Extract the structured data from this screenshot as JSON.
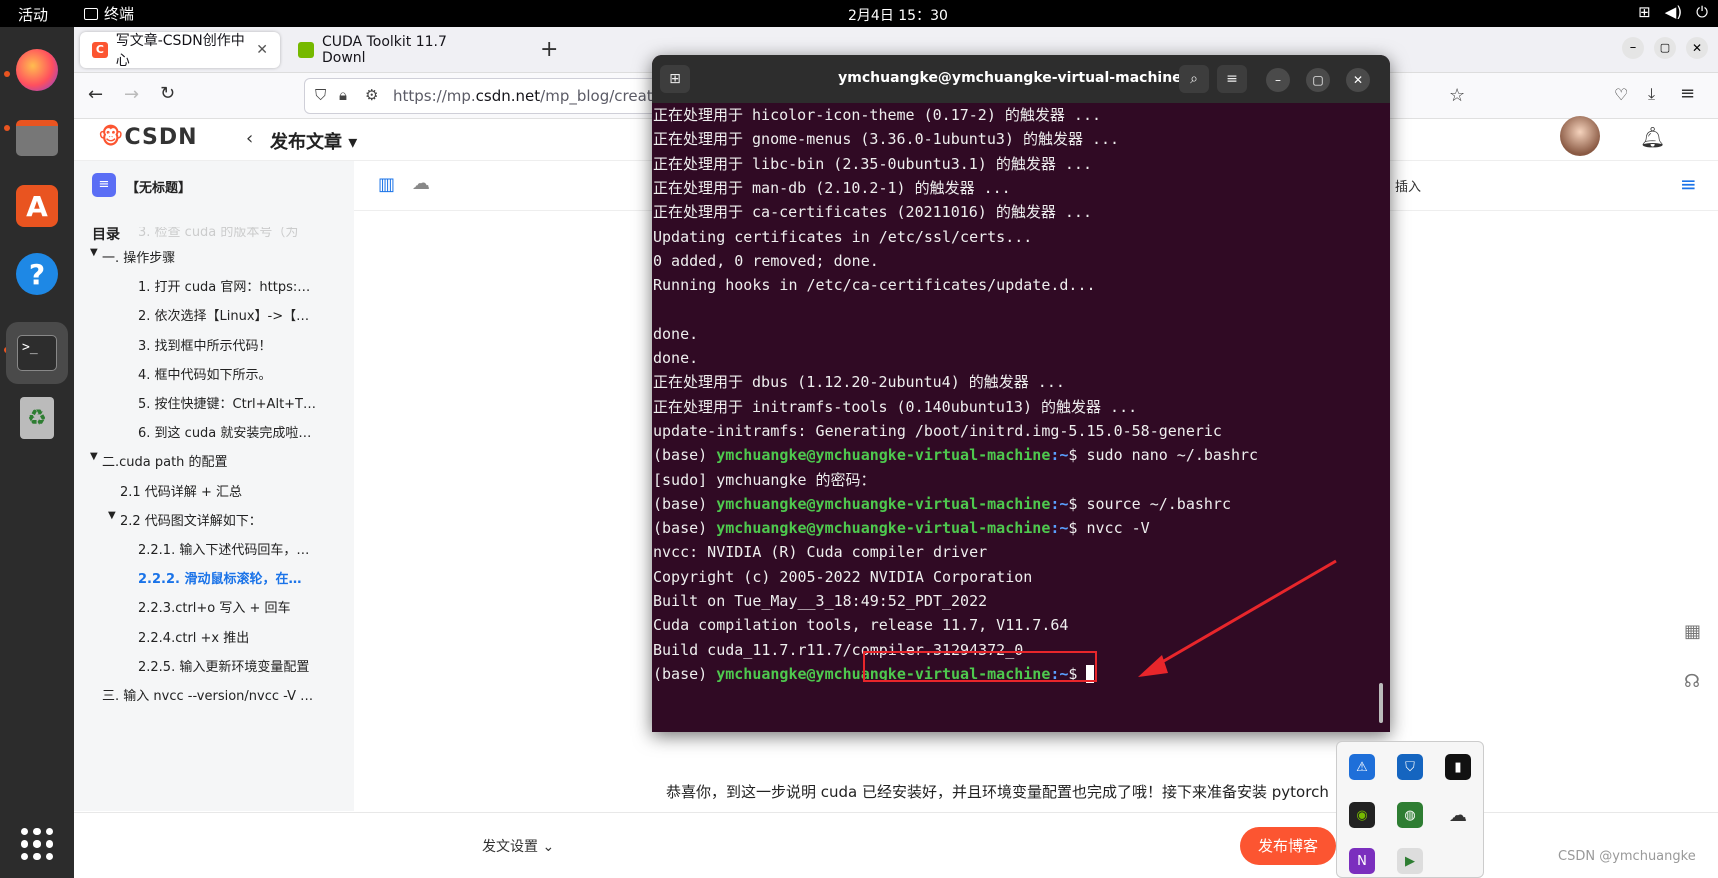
{
  "topbar": {
    "activities": "活动",
    "app": "终端",
    "clock": "2月4日  15：30",
    "sys_icons": [
      "network-icon",
      "volume-icon",
      "power-icon"
    ]
  },
  "browser": {
    "tab1": "写文章-CSDN创作中心",
    "tab2": "CUDA Toolkit 11.7 Downl",
    "url_prefix": "https://mp.",
    "url_domain": "csdn.net",
    "url_rest": "/mp_blog/creatio"
  },
  "csdn": {
    "logo": "CSDN",
    "publish_title": "发布文章",
    "doc_title": "【无标题】",
    "toc_label": "目录",
    "insert_label": "插入",
    "toc": [
      {
        "text": "3. 检查 cuda 的版本号（为",
        "indent": 2,
        "arrow": false,
        "sel": false
      },
      {
        "text": "一. 操作步骤",
        "indent": 0,
        "arrow": true,
        "sel": false
      },
      {
        "text": "1. 打开 cuda 官网：https:…",
        "indent": 2,
        "arrow": false,
        "sel": false
      },
      {
        "text": "2. 依次选择【Linux】->【…",
        "indent": 2,
        "arrow": false,
        "sel": false
      },
      {
        "text": "3. 找到框中所示代码！",
        "indent": 2,
        "arrow": false,
        "sel": false
      },
      {
        "text": "4. 框中代码如下所示。",
        "indent": 2,
        "arrow": false,
        "sel": false
      },
      {
        "text": "5. 按住快捷键：Ctrl+Alt+T…",
        "indent": 2,
        "arrow": false,
        "sel": false
      },
      {
        "text": "6. 到这 cuda 就安装完成啦…",
        "indent": 2,
        "arrow": false,
        "sel": false
      },
      {
        "text": "二.cuda path 的配置",
        "indent": 0,
        "arrow": true,
        "sel": false
      },
      {
        "text": "2.1 代码详解 + 汇总",
        "indent": 1,
        "arrow": false,
        "sel": false
      },
      {
        "text": "2.2 代码图文详解如下：",
        "indent": 1,
        "arrow": true,
        "sel": false
      },
      {
        "text": "2.2.1. 输入下述代码回车，…",
        "indent": 2,
        "arrow": false,
        "sel": false
      },
      {
        "text": "2.2.2. 滑动鼠标滚轮，在…",
        "indent": 2,
        "arrow": false,
        "sel": true
      },
      {
        "text": "2.2.3.ctrl+o 写入 + 回车",
        "indent": 2,
        "arrow": false,
        "sel": false
      },
      {
        "text": "2.2.4.ctrl +x 推出",
        "indent": 2,
        "arrow": false,
        "sel": false
      },
      {
        "text": "2.2.5. 输入更新环境变量配置",
        "indent": 2,
        "arrow": false,
        "sel": false
      },
      {
        "text": "三. 输入 nvcc --version/nvcc -V …",
        "indent": 0,
        "arrow": false,
        "sel": false
      }
    ],
    "body_text": "恭喜你，到这一步说明 cuda 已经安装好，并且环境变量配置也完成了哦！接下来准备安装 pytorch",
    "footer_settings": "发文设置",
    "publish_button": "发布博客",
    "watermark": "CSDN @ymchuangke"
  },
  "terminal": {
    "title": "ymchuangke@ymchuangke-virtual-machine: ~",
    "lines": [
      {
        "t": "正在处理用于 hicolor-icon-theme (0.17-2) 的触发器 ..."
      },
      {
        "t": "正在处理用于 gnome-menus (3.36.0-1ubuntu3) 的触发器 ..."
      },
      {
        "t": "正在处理用于 libc-bin (2.35-0ubuntu3.1) 的触发器 ..."
      },
      {
        "t": "正在处理用于 man-db (2.10.2-1) 的触发器 ..."
      },
      {
        "t": "正在处理用于 ca-certificates (20211016) 的触发器 ..."
      },
      {
        "t": "Updating certificates in /etc/ssl/certs..."
      },
      {
        "t": "0 added, 0 removed; done."
      },
      {
        "t": "Running hooks in /etc/ca-certificates/update.d..."
      },
      {
        "t": ""
      },
      {
        "t": "done."
      },
      {
        "t": "done."
      },
      {
        "t": "正在处理用于 dbus (1.12.20-2ubuntu4) 的触发器 ..."
      },
      {
        "t": "正在处理用于 initramfs-tools (0.140ubuntu13) 的触发器 ..."
      },
      {
        "t": "update-initramfs: Generating /boot/initrd.img-5.15.0-58-generic"
      },
      {
        "prompt": true,
        "cmd": "sudo nano ~/.bashrc"
      },
      {
        "t": "[sudo] ymchuangke 的密码："
      },
      {
        "prompt": true,
        "cmd": "source ~/.bashrc"
      },
      {
        "prompt": true,
        "cmd": "nvcc -V"
      },
      {
        "t": "nvcc: NVIDIA (R) Cuda compiler driver"
      },
      {
        "t": "Copyright (c) 2005-2022 NVIDIA Corporation"
      },
      {
        "t": "Built on Tue_May__3_18:49:52_PDT_2022"
      },
      {
        "t": "Cuda compilation tools, release 11.7, V11.7.64"
      },
      {
        "t": "Build cuda_11.7.r11.7/compiler.31294372_0"
      },
      {
        "prompt": true,
        "cmd": "",
        "cursor": true
      }
    ],
    "prompt_base": "(base) ",
    "prompt_user": "ymchuangke@ymchuangke-virtual-machine",
    "prompt_path": ":~",
    "prompt_sym": "$ "
  },
  "colors": {
    "terminal_bg": "#300a24",
    "annotation_red": "#e8262b",
    "csdn_orange": "#fc5531"
  }
}
